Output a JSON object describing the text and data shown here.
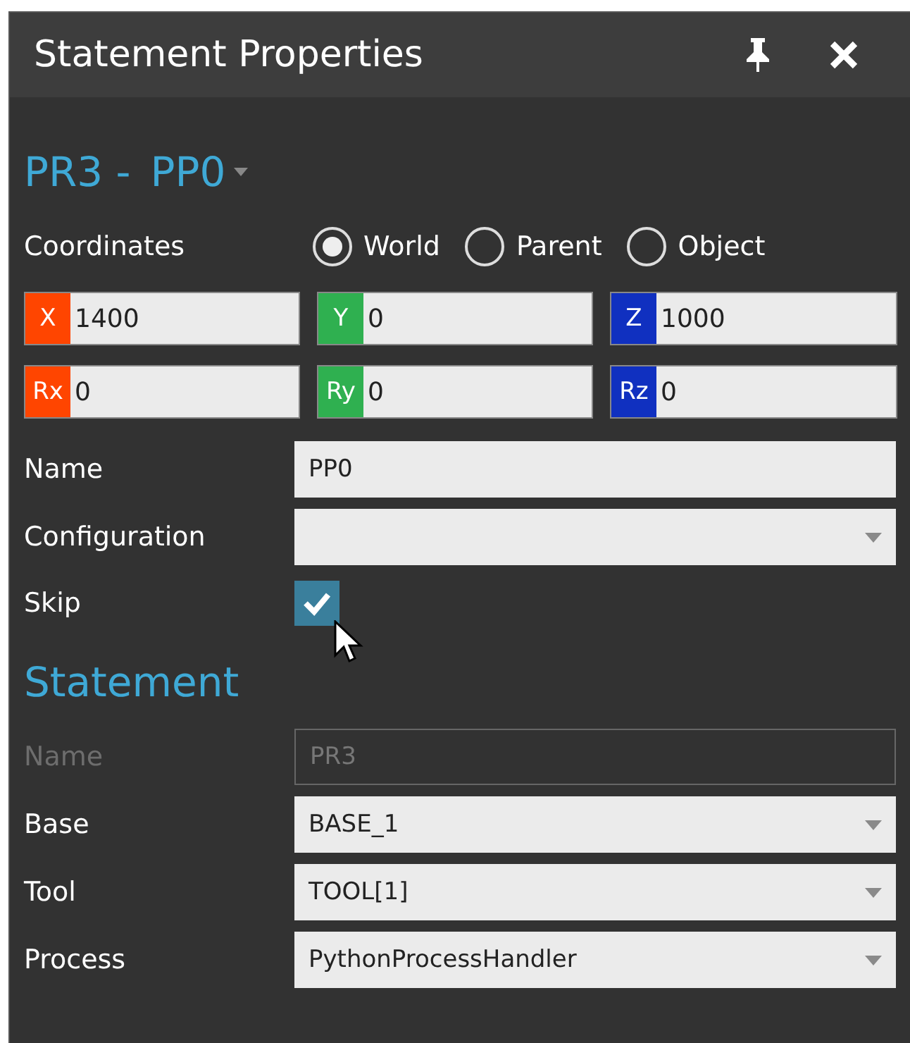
{
  "window": {
    "title": "Statement Properties"
  },
  "header": {
    "target": "PR3 -",
    "point": "PP0"
  },
  "coordinates": {
    "label": "Coordinates",
    "options": [
      {
        "label": "World",
        "selected": true
      },
      {
        "label": "Parent",
        "selected": false
      },
      {
        "label": "Object",
        "selected": false
      }
    ]
  },
  "axes": [
    {
      "label": "X",
      "value": "1400",
      "color": "#ff4500"
    },
    {
      "label": "Y",
      "value": "0",
      "color": "#2fb050"
    },
    {
      "label": "Z",
      "value": "1000",
      "color": "#1030c0"
    },
    {
      "label": "Rx",
      "value": "0",
      "color": "#ff4500"
    },
    {
      "label": "Ry",
      "value": "0",
      "color": "#2fb050"
    },
    {
      "label": "Rz",
      "value": "0",
      "color": "#1030c0"
    }
  ],
  "point_fields": [
    {
      "kind": "text",
      "label": "Name",
      "value": "PP0",
      "disabled": false
    },
    {
      "kind": "dropdown",
      "label": "Configuration",
      "disabled": false
    },
    {
      "kind": "checkbox",
      "label": "Skip",
      "checked": true,
      "disabled": false
    }
  ],
  "statement": {
    "title": "Statement",
    "fields": [
      {
        "kind": "text",
        "label": "Name",
        "value": "PR3",
        "disabled": true
      },
      {
        "kind": "dropdown",
        "label": "Base",
        "value": "BASE_1",
        "disabled": false
      },
      {
        "kind": "dropdown",
        "label": "Tool",
        "value": "TOOL[1]",
        "disabled": false
      },
      {
        "kind": "dropdown",
        "label": "Process",
        "value": "PythonProcessHandler",
        "disabled": false
      }
    ]
  }
}
